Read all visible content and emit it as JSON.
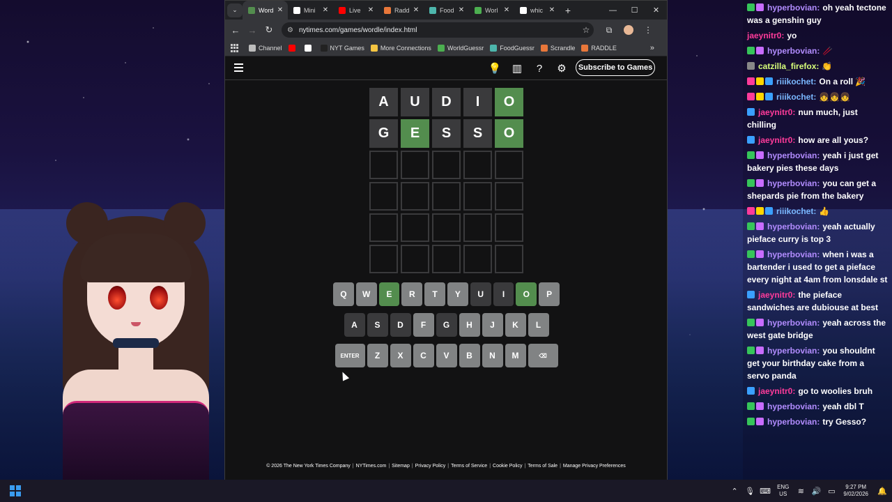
{
  "browser": {
    "tabs": [
      {
        "label": "Word",
        "color": "#538d4e",
        "active": true
      },
      {
        "label": "Mini",
        "color": "#ffffff",
        "active": false
      },
      {
        "label": "Live",
        "color": "#ff0000",
        "active": false
      },
      {
        "label": "Radd",
        "color": "#e8773a",
        "active": false
      },
      {
        "label": "Food",
        "color": "#4db6ac",
        "active": false
      },
      {
        "label": "Worl",
        "color": "#4caf50",
        "active": false
      },
      {
        "label": "whic",
        "color": "#ffffff",
        "active": false
      }
    ],
    "url": "nytimes.com/games/wordle/index.html",
    "bookmarks": [
      {
        "label": "Channel",
        "color": "#bdbdbd"
      },
      {
        "label": "",
        "color": "#ff0000"
      },
      {
        "label": "",
        "color": "#ffffff"
      },
      {
        "label": "NYT Games",
        "color": "#222222"
      },
      {
        "label": "More Connections",
        "color": "#f5c542"
      },
      {
        "label": "WorldGuessr",
        "color": "#4caf50"
      },
      {
        "label": "FoodGuessr",
        "color": "#4db6ac"
      },
      {
        "label": "Scrandle",
        "color": "#e8773a"
      },
      {
        "label": "RADDLE",
        "color": "#e8773a"
      }
    ]
  },
  "wordle": {
    "subscribe_label": "Subscribe to Games",
    "rows": [
      [
        {
          "l": "A",
          "s": "absent"
        },
        {
          "l": "U",
          "s": "absent"
        },
        {
          "l": "D",
          "s": "absent"
        },
        {
          "l": "I",
          "s": "absent"
        },
        {
          "l": "O",
          "s": "correct"
        }
      ],
      [
        {
          "l": "G",
          "s": "absent"
        },
        {
          "l": "E",
          "s": "correct"
        },
        {
          "l": "S",
          "s": "absent"
        },
        {
          "l": "S",
          "s": "absent"
        },
        {
          "l": "O",
          "s": "correct"
        }
      ],
      [
        {
          "l": "",
          "s": "empty"
        },
        {
          "l": "",
          "s": "empty"
        },
        {
          "l": "",
          "s": "empty"
        },
        {
          "l": "",
          "s": "empty"
        },
        {
          "l": "",
          "s": "empty"
        }
      ],
      [
        {
          "l": "",
          "s": "empty"
        },
        {
          "l": "",
          "s": "empty"
        },
        {
          "l": "",
          "s": "empty"
        },
        {
          "l": "",
          "s": "empty"
        },
        {
          "l": "",
          "s": "empty"
        }
      ],
      [
        {
          "l": "",
          "s": "empty"
        },
        {
          "l": "",
          "s": "empty"
        },
        {
          "l": "",
          "s": "empty"
        },
        {
          "l": "",
          "s": "empty"
        },
        {
          "l": "",
          "s": "empty"
        }
      ],
      [
        {
          "l": "",
          "s": "empty"
        },
        {
          "l": "",
          "s": "empty"
        },
        {
          "l": "",
          "s": "empty"
        },
        {
          "l": "",
          "s": "empty"
        },
        {
          "l": "",
          "s": "empty"
        }
      ]
    ],
    "keyboard": [
      [
        {
          "k": "Q",
          "s": "unused"
        },
        {
          "k": "W",
          "s": "unused"
        },
        {
          "k": "E",
          "s": "correct"
        },
        {
          "k": "R",
          "s": "unused"
        },
        {
          "k": "T",
          "s": "unused"
        },
        {
          "k": "Y",
          "s": "unused"
        },
        {
          "k": "U",
          "s": "absent"
        },
        {
          "k": "I",
          "s": "absent"
        },
        {
          "k": "O",
          "s": "correct"
        },
        {
          "k": "P",
          "s": "unused"
        }
      ],
      [
        {
          "k": "A",
          "s": "absent"
        },
        {
          "k": "S",
          "s": "absent"
        },
        {
          "k": "D",
          "s": "absent"
        },
        {
          "k": "F",
          "s": "unused"
        },
        {
          "k": "G",
          "s": "absent"
        },
        {
          "k": "H",
          "s": "unused"
        },
        {
          "k": "J",
          "s": "unused"
        },
        {
          "k": "K",
          "s": "unused"
        },
        {
          "k": "L",
          "s": "unused"
        }
      ],
      [
        {
          "k": "ENTER",
          "s": "unused",
          "wide": true
        },
        {
          "k": "Z",
          "s": "unused"
        },
        {
          "k": "X",
          "s": "unused"
        },
        {
          "k": "C",
          "s": "unused"
        },
        {
          "k": "V",
          "s": "unused"
        },
        {
          "k": "B",
          "s": "unused"
        },
        {
          "k": "N",
          "s": "unused"
        },
        {
          "k": "M",
          "s": "unused"
        },
        {
          "k": "⌫",
          "s": "unused",
          "wide": true
        }
      ]
    ],
    "footer": [
      "© 2026 The New York Times Company",
      "NYTimes.com",
      "Sitemap",
      "Privacy Policy",
      "Terms of Service",
      "Cookie Policy",
      "Terms of Sale",
      "Manage Privacy Preferences"
    ]
  },
  "chat": [
    {
      "user": "hyperbovian",
      "color": "#b28cff",
      "badges": [
        "#36c45a",
        "#c86cff"
      ],
      "text": "oh yeah tectone was a genshin guy"
    },
    {
      "user": "jaeynitr0",
      "color": "#ff3b9a",
      "badges": [],
      "text": "yo"
    },
    {
      "user": "hyperbovian",
      "color": "#b28cff",
      "badges": [
        "#36c45a",
        "#c86cff"
      ],
      "text": "🥢"
    },
    {
      "user": "catzilla_firefox",
      "color": "#d8ff7a",
      "badges": [
        "#888888"
      ],
      "text": "👏"
    },
    {
      "user": "riiikochet",
      "color": "#7ab8ff",
      "badges": [
        "#ff3b9a",
        "#ffd600",
        "#3aa0ff"
      ],
      "text": "On a roll 🎉"
    },
    {
      "user": "riiikochet",
      "color": "#7ab8ff",
      "badges": [
        "#ff3b9a",
        "#ffd600",
        "#3aa0ff"
      ],
      "text": "👧👧👧"
    },
    {
      "user": "jaeynitr0",
      "color": "#ff3b9a",
      "badges": [
        "#3aa0ff"
      ],
      "text": "nun much, just chilling"
    },
    {
      "user": "jaeynitr0",
      "color": "#ff3b9a",
      "badges": [
        "#3aa0ff"
      ],
      "text": "how are all yous?"
    },
    {
      "user": "hyperbovian",
      "color": "#b28cff",
      "badges": [
        "#36c45a",
        "#c86cff"
      ],
      "text": "yeah i just get bakery pies these days"
    },
    {
      "user": "hyperbovian",
      "color": "#b28cff",
      "badges": [
        "#36c45a",
        "#c86cff"
      ],
      "text": "you can get a shepards pie from the bakery"
    },
    {
      "user": "riiikochet",
      "color": "#7ab8ff",
      "badges": [
        "#ff3b9a",
        "#ffd600",
        "#3aa0ff"
      ],
      "text": "👍"
    },
    {
      "user": "hyperbovian",
      "color": "#b28cff",
      "badges": [
        "#36c45a",
        "#c86cff"
      ],
      "text": "yeah actually pieface curry is top 3"
    },
    {
      "user": "hyperbovian",
      "color": "#b28cff",
      "badges": [
        "#36c45a",
        "#c86cff"
      ],
      "text": "when i was a bartender i used to get a pieface every night at 4am from lonsdale st"
    },
    {
      "user": "jaeynitr0",
      "color": "#ff3b9a",
      "badges": [
        "#3aa0ff"
      ],
      "text": "the pieface sandwiches are dubiouse at best"
    },
    {
      "user": "hyperbovian",
      "color": "#b28cff",
      "badges": [
        "#36c45a",
        "#c86cff"
      ],
      "text": "yeah across the west gate bridge"
    },
    {
      "user": "hyperbovian",
      "color": "#b28cff",
      "badges": [
        "#36c45a",
        "#c86cff"
      ],
      "text": "you shouldnt get your birthday cake from a servo panda"
    },
    {
      "user": "jaeynitr0",
      "color": "#ff3b9a",
      "badges": [
        "#3aa0ff"
      ],
      "text": "go to woolies bruh"
    },
    {
      "user": "hyperbovian",
      "color": "#b28cff",
      "badges": [
        "#36c45a",
        "#c86cff"
      ],
      "text": "yeah dbl T"
    },
    {
      "user": "hyperbovian",
      "color": "#b28cff",
      "badges": [
        "#36c45a",
        "#c86cff"
      ],
      "text": "try Gesso?"
    }
  ],
  "taskbar": {
    "lang_top": "ENG",
    "lang_bottom": "US",
    "time": "9:27 PM",
    "date": "9/02/2026"
  }
}
